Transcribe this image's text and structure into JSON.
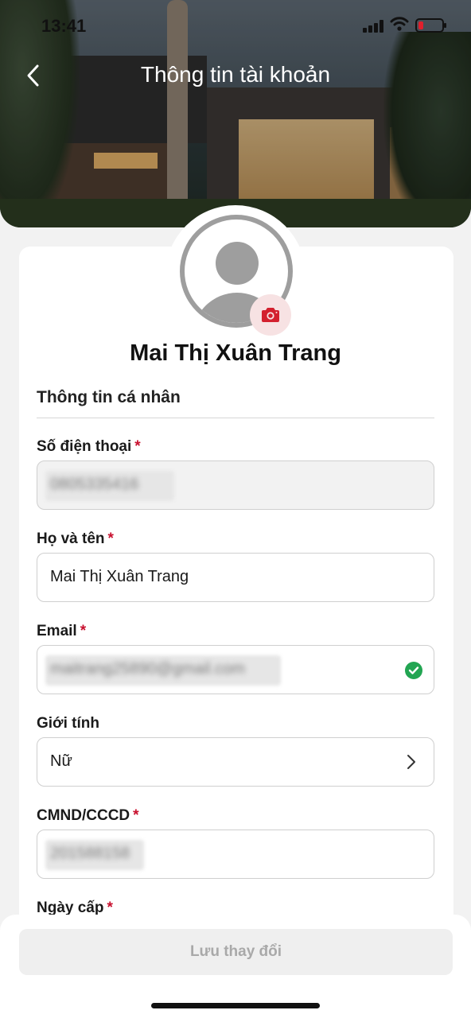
{
  "status_bar": {
    "time": "13:41"
  },
  "header": {
    "title": "Thông tin tài khoản"
  },
  "profile": {
    "name": "Mai Thị Xuân Trang"
  },
  "section": {
    "title": "Thông tin cá nhân"
  },
  "fields": {
    "phone": {
      "label": "Số điện thoại",
      "required": "*",
      "value": "0805335416"
    },
    "full_name": {
      "label": "Họ và tên",
      "required": "*",
      "value": "Mai Thị Xuân Trang"
    },
    "email": {
      "label": "Email",
      "required": "*",
      "value": "maitrang25890@gmail.com"
    },
    "gender": {
      "label": "Giới tính",
      "value": "Nữ"
    },
    "id_card": {
      "label": "CMND/CCCD",
      "required": "*",
      "value": "201588158"
    },
    "issue_date": {
      "label": "Ngày cấp",
      "required": "*"
    }
  },
  "footer": {
    "save_label": "Lưu thay đổi"
  },
  "icons": {
    "back": "chevron-left-icon",
    "camera": "camera-icon",
    "verified": "check-circle-icon",
    "gender_select": "chevron-right-icon"
  },
  "colors": {
    "accent": "#c8102e",
    "success": "#22a552",
    "disabled_button": "#efefef"
  }
}
